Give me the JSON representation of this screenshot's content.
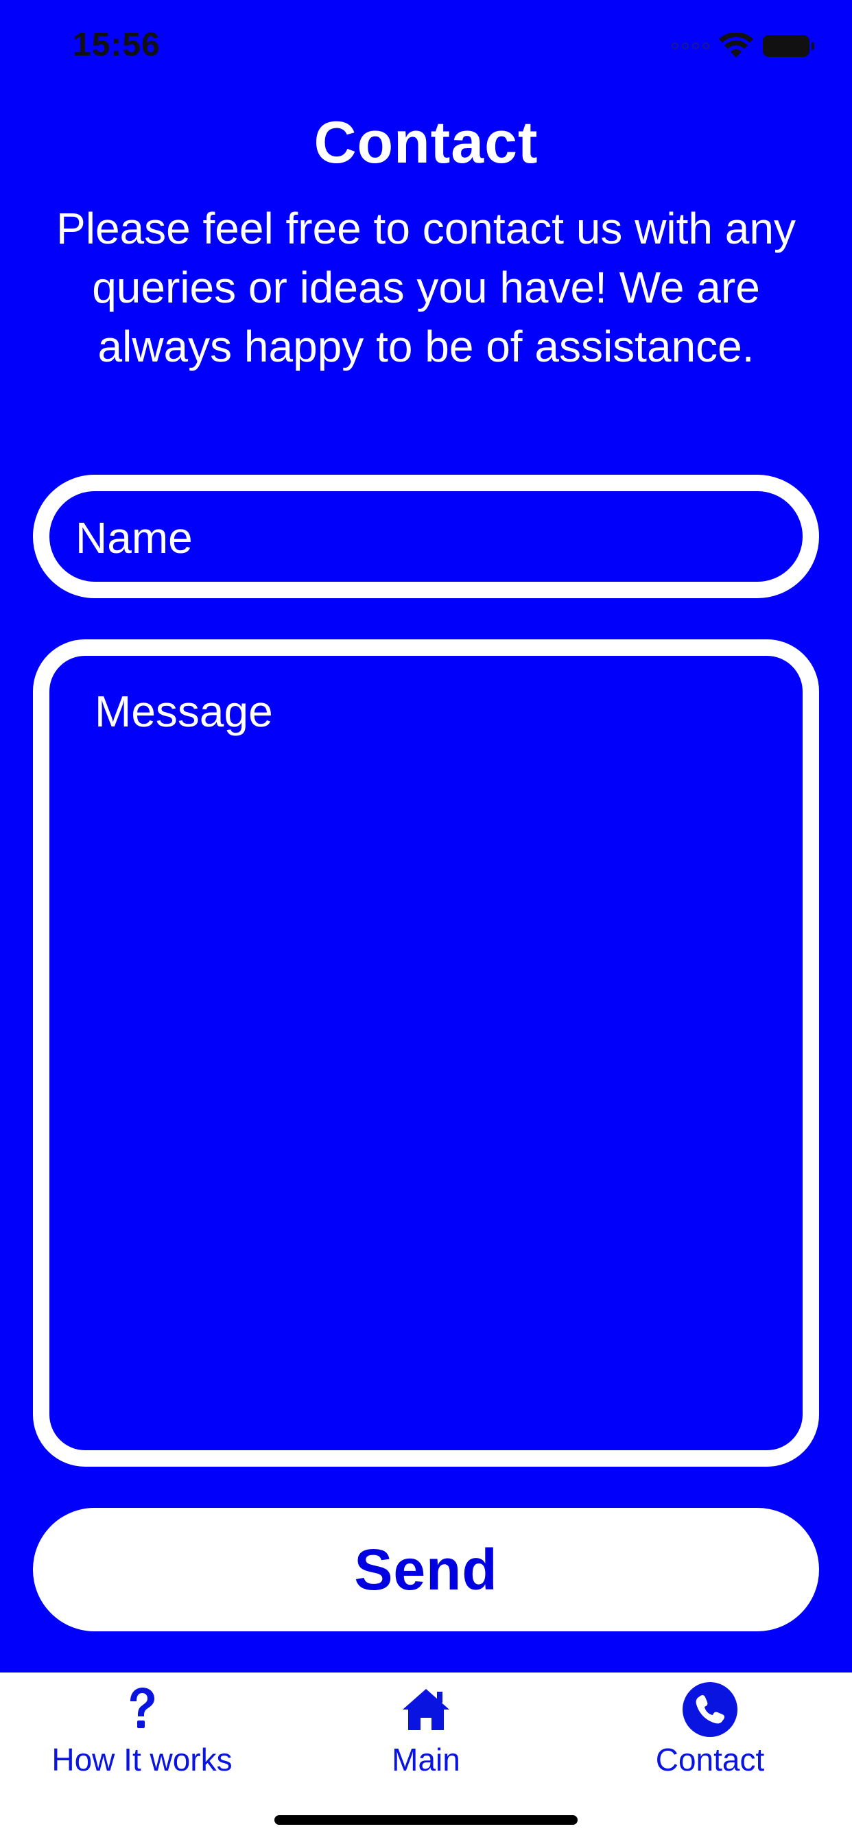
{
  "status_bar": {
    "time": "15:56"
  },
  "page": {
    "title": "Contact",
    "intro": "Please feel free to contact us with any queries or ideas you have! We are always happy to be of assistance."
  },
  "form": {
    "name_placeholder": "Name",
    "name_value": "",
    "message_placeholder": "Message",
    "message_value": "",
    "send_label": "Send"
  },
  "tab_bar": {
    "items": [
      {
        "label": "How It works",
        "icon": "question-icon"
      },
      {
        "label": "Main",
        "icon": "house-icon"
      },
      {
        "label": "Contact",
        "icon": "phone-icon"
      }
    ],
    "selected": "Contact"
  },
  "colors": {
    "background": "#0000fb",
    "foreground": "#ffffff",
    "tab_tint": "#0a14e0"
  }
}
